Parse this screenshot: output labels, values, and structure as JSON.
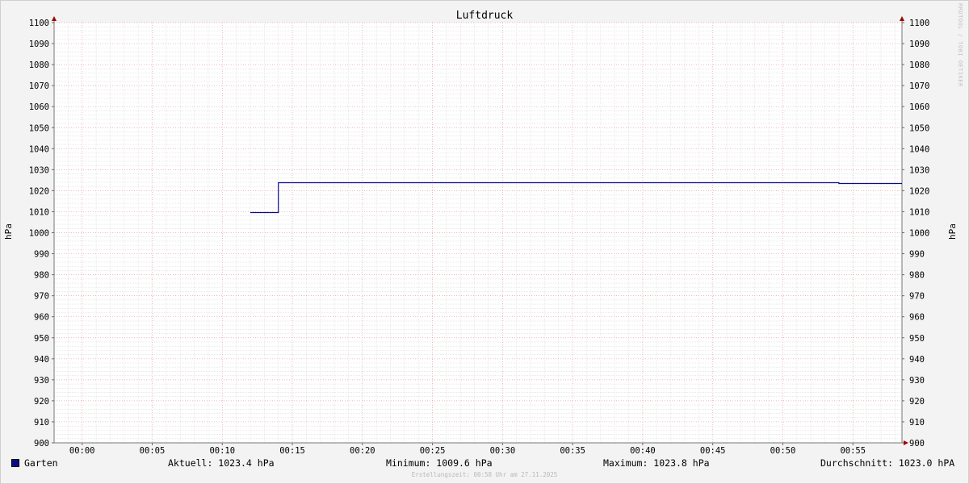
{
  "chart_data": {
    "type": "line",
    "title": "Luftdruck",
    "ylabel_left": "hPa",
    "ylabel_right": "hPa",
    "ylim": [
      900,
      1100
    ],
    "y_ticks": [
      900,
      910,
      920,
      930,
      940,
      950,
      960,
      970,
      980,
      990,
      1000,
      1010,
      1020,
      1030,
      1040,
      1050,
      1060,
      1070,
      1080,
      1090,
      1100
    ],
    "x_ticks": [
      "00:00",
      "00:05",
      "00:10",
      "00:15",
      "00:20",
      "00:25",
      "00:30",
      "00:35",
      "00:40",
      "00:45",
      "00:50",
      "00:55"
    ],
    "xlim_minutes": [
      -2,
      58.5
    ],
    "grid": true,
    "series": [
      {
        "name": "Garten",
        "color": "#0a0a8c",
        "points": [
          {
            "t": 12.0,
            "v": 1009.6
          },
          {
            "t": 14.0,
            "v": 1009.6
          },
          {
            "t": 14.0,
            "v": 1023.8
          },
          {
            "t": 54.0,
            "v": 1023.8
          },
          {
            "t": 54.0,
            "v": 1023.4
          },
          {
            "t": 58.5,
            "v": 1023.4
          }
        ]
      }
    ]
  },
  "legend": {
    "series_name": "Garten",
    "current": "Aktuell: 1023.4 hPa",
    "minimum": "Minimum: 1009.6 hPa",
    "maximum": "Maximum: 1023.8 hPa",
    "average": "Durchschnitt: 1023.0 hPA"
  },
  "footer": "Erstellungszeit: 00:58 Uhr am 27.11.2025",
  "watermark": "RRDTOOL / TOBI OETIKER"
}
